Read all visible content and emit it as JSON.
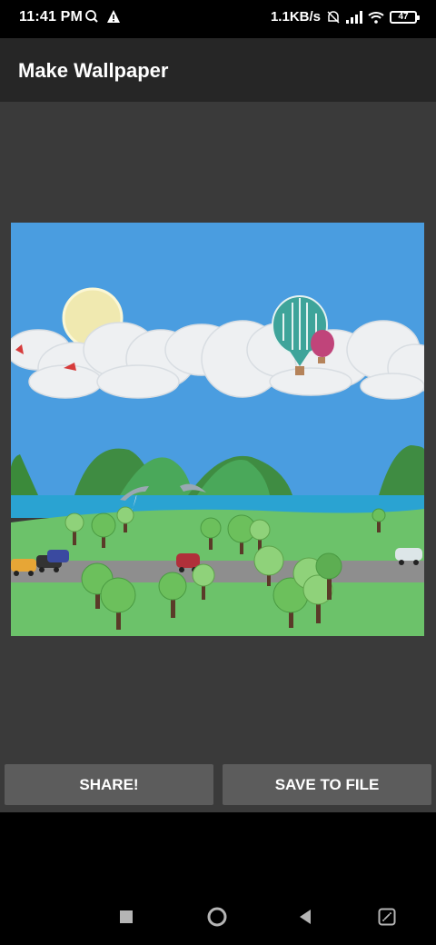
{
  "status_bar": {
    "time": "11:41 PM",
    "network_speed": "1.1KB/s",
    "battery": "47",
    "icons": [
      "sync-icon",
      "warning-icon",
      "mute-icon",
      "signal-icon",
      "wifi-icon",
      "battery-icon"
    ]
  },
  "app_bar": {
    "title": "Make Wallpaper"
  },
  "actions": {
    "share_label": "SHARE!",
    "save_label": "SAVE TO FILE"
  },
  "nav_bar": {
    "icons": [
      "recents-icon",
      "home-icon",
      "back-icon",
      "screenshot-icon"
    ]
  },
  "colors": {
    "status_bg": "#000000",
    "appbar_bg": "#262626",
    "content_bg": "#3a3a3a",
    "button_bg": "#5c5c5c",
    "sky": "#4a9de0",
    "grass": "#6cc26a",
    "water": "#2aa3d2"
  }
}
